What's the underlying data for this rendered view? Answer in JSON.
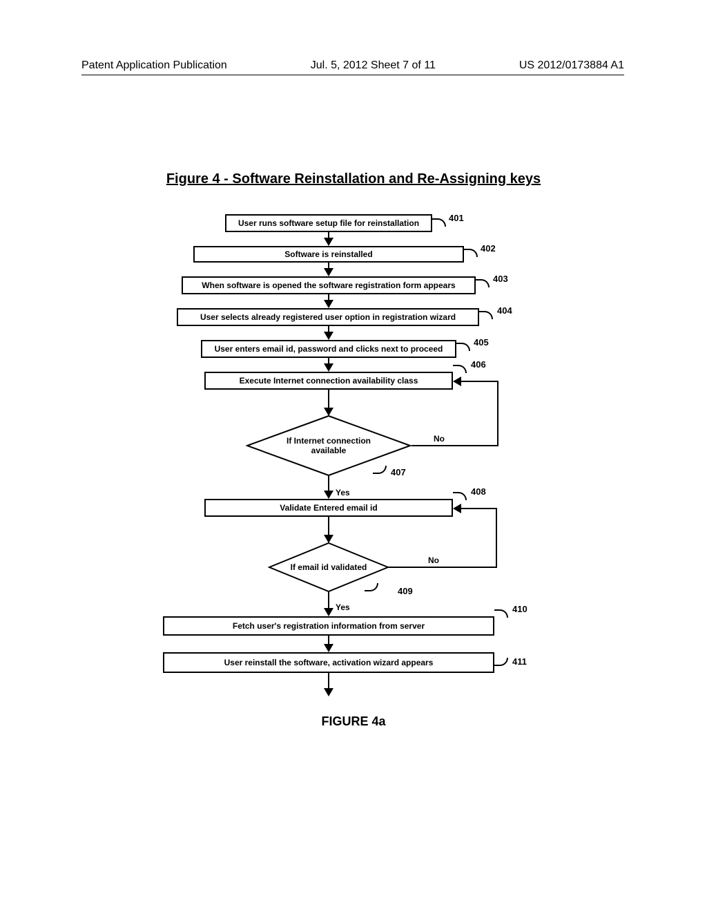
{
  "header": {
    "left": "Patent Application Publication",
    "center": "Jul. 5, 2012   Sheet 7 of 11",
    "right": "US 2012/0173884 A1"
  },
  "figure_title": "Figure 4 - Software Reinstallation and Re-Assigning keys",
  "figure_caption": "FIGURE 4a",
  "steps": {
    "s401": {
      "text": "User runs software setup file for reinstallation",
      "ref": "401"
    },
    "s402": {
      "text": "Software is reinstalled",
      "ref": "402"
    },
    "s403": {
      "text": "When software is opened the software registration form appears",
      "ref": "403"
    },
    "s404": {
      "text": "User selects already registered user option in registration wizard",
      "ref": "404"
    },
    "s405": {
      "text": "User enters  email id, password and clicks next to proceed",
      "ref": "405"
    },
    "s406": {
      "text": "Execute Internet connection availability  class",
      "ref": "406"
    },
    "s407": {
      "text": "If Internet connection available",
      "ref": "407",
      "yes": "Yes",
      "no": "No"
    },
    "s408": {
      "text": "Validate Entered  email id",
      "ref": "408"
    },
    "s409": {
      "text": "If email id validated",
      "ref": "409",
      "yes": "Yes",
      "no": "No"
    },
    "s410": {
      "text": "Fetch user's registration information from server",
      "ref": "410"
    },
    "s411": {
      "text": "User reinstall the software,  activation wizard appears",
      "ref": "411"
    }
  }
}
